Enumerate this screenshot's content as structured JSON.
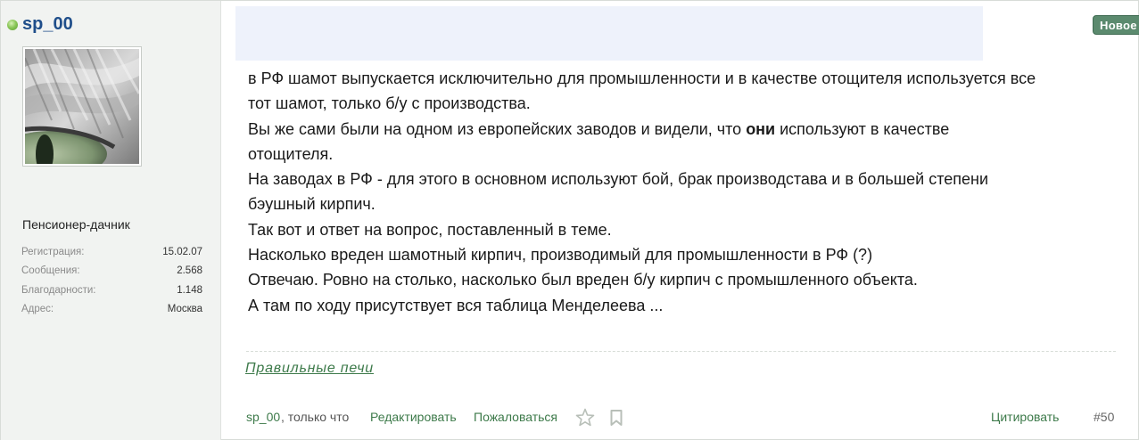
{
  "author": {
    "username": "sp_00",
    "title": "Пенсионер-дачник",
    "stats": [
      {
        "label": "Регистрация:",
        "value": "15.02.07"
      },
      {
        "label": "Сообщения:",
        "value": "2.568"
      },
      {
        "label": "Благодарности:",
        "value": "1.148"
      },
      {
        "label": "Адрес:",
        "value": "Москва"
      }
    ]
  },
  "badge": {
    "new_label": "Новое"
  },
  "message": {
    "lines": [
      "в РФ шамот выпускается исключительно для промышленности и в качестве отощителя используется все",
      "тот шамот, только б/у с производства.",
      "Вы же сами были на одном из европейских заводов и видели, что ",
      "отощителя.",
      "На заводах в РФ - для этого в основном используют бой, брак производстава и в большей степени",
      "бэушный кирпич.",
      "Так вот и ответ на вопрос, поставленный в теме.",
      "Насколько вреден шамотный кирпич, производимый для промышленности в РФ (?)",
      "Отвечаю. Ровно на столько, насколько был вреден б/у кирпич с промышленного объекта.",
      "А там по ходу присутствует вся таблица Менделеева ..."
    ],
    "line3_bold": "они",
    "line3_tail": " используют в качестве"
  },
  "signature": {
    "text": "Правильные печи"
  },
  "footer": {
    "author_link": "sp_00",
    "status": " , только что",
    "edit": "Редактировать",
    "report": "Пожаловаться",
    "quote": "Цитировать",
    "post_number": "#50",
    "icons": [
      "star-icon",
      "bookmark-icon"
    ]
  },
  "colors": {
    "username": "#1f4e8a",
    "link": "#3d7a4a",
    "badge": "#5b8a6e",
    "sidebar_bg": "#f1f3f1"
  }
}
